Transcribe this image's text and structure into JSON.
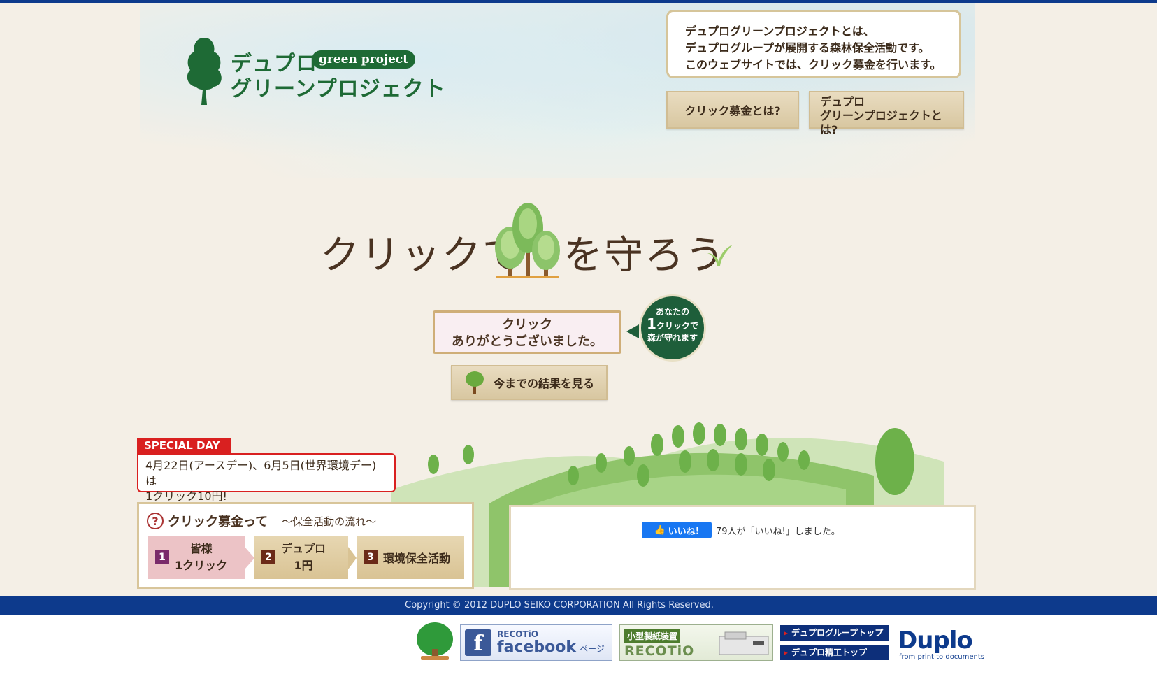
{
  "logo": {
    "line1": "デュプロ",
    "badge": "green project",
    "line2": "グリーンプロジェクト"
  },
  "intro": {
    "lines": [
      "デュプログリーンプロジェクトとは、",
      "デュプログループが展開する森林保全活動です。",
      "このウェブサイトでは、クリック募金を行います。"
    ]
  },
  "nav": {
    "click_donation": "クリック募金とは?",
    "project_line1": "デュプロ",
    "project_line2": "グリーンプロジェクトとは?"
  },
  "headline": {
    "left": "クリックで",
    "right": "を守ろう"
  },
  "thanks": {
    "line1": "クリック",
    "line2": "ありがとうございました。"
  },
  "bubble": {
    "line1": "あなたの",
    "num": "1",
    "line2": "クリックで",
    "line3": "森が守れます"
  },
  "results_button": "今までの結果を見る",
  "special_day": {
    "tag": "SPECIAL DAY",
    "line1": "4月22日(アースデー)、6月5日(世界環境デー)は",
    "line2": "1クリック10円!"
  },
  "flow": {
    "q": "?",
    "title": "クリック募金って",
    "subtitle": "〜保全活動の流れ〜",
    "steps": [
      {
        "num": "1",
        "line1": "皆様",
        "line2": "1クリック"
      },
      {
        "num": "2",
        "line1": "デュプロ",
        "line2": "1円"
      },
      {
        "num": "3",
        "line1": "環境保全活動",
        "line2": ""
      }
    ]
  },
  "like": {
    "button": "いいね!",
    "count_text": "79人が「いいね!」しました。"
  },
  "footer": {
    "copyright": "Copyright © 2012 DUPLO SEIKO CORPORATION All Rights Reserved.",
    "facebook_small": "RECOTiO",
    "facebook_big": "facebook",
    "facebook_page": "ページ",
    "recotio_top": "小型製紙装置",
    "recotio_bottom": "RECOTiO",
    "link_group": "デュプログループトップ",
    "link_seiko": "デュプロ精工トップ",
    "duplo_logo": "Duplo",
    "duplo_tagline": "from print to documents"
  },
  "colors": {
    "brand_green": "#1e6a35",
    "footer_blue": "#0d3a8c",
    "special_red": "#d92020",
    "facebook_blue": "#1877f2"
  }
}
